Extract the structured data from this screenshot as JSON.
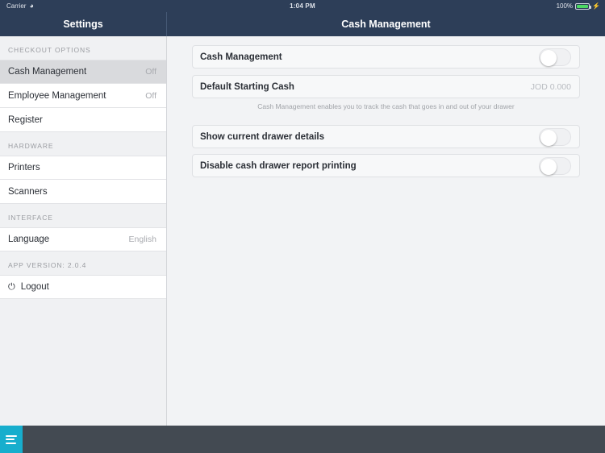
{
  "statusbar": {
    "carrier": "Carrier",
    "wifi_icon": "wifi-icon",
    "time": "1:04 PM",
    "battery_percent": "100%",
    "battery_icon": "battery-full-icon",
    "charging_icon": "lightning-bolt-icon"
  },
  "navbar": {
    "sidebar_title": "Settings",
    "detail_title": "Cash Management"
  },
  "sidebar": {
    "sections": [
      {
        "header": "CHECKOUT OPTIONS",
        "items": [
          {
            "label": "Cash Management",
            "value": "Off",
            "selected": true
          },
          {
            "label": "Employee Management",
            "value": "Off",
            "selected": false
          },
          {
            "label": "Register",
            "value": "",
            "selected": false
          }
        ]
      },
      {
        "header": "HARDWARE",
        "items": [
          {
            "label": "Printers",
            "value": "",
            "selected": false
          },
          {
            "label": "Scanners",
            "value": "",
            "selected": false
          }
        ]
      },
      {
        "header": "INTERFACE",
        "items": [
          {
            "label": "Language",
            "value": "English",
            "selected": false
          }
        ]
      }
    ],
    "app_version": "APP VERSION: 2.0.4",
    "logout": {
      "label": "Logout",
      "icon": "power-icon"
    }
  },
  "content": {
    "rows": [
      {
        "label": "Cash Management",
        "type": "toggle",
        "state": "off"
      },
      {
        "label": "Default Starting Cash",
        "type": "value",
        "value": "JOD 0.000"
      },
      {
        "label": "Show current drawer details",
        "type": "toggle",
        "state": "off"
      },
      {
        "label": "Disable cash drawer report printing",
        "type": "toggle",
        "state": "off"
      }
    ],
    "hint": "Cash Management enables you to track the cash that goes in and out of your drawer"
  },
  "bottombar": {
    "menu_icon": "hamburger-menu-icon"
  },
  "colors": {
    "navbar": "#2d3e58",
    "accent": "#17aecd",
    "bottombar": "#434a52",
    "battery": "#4cd964",
    "selected_row": "#d9dadd"
  }
}
